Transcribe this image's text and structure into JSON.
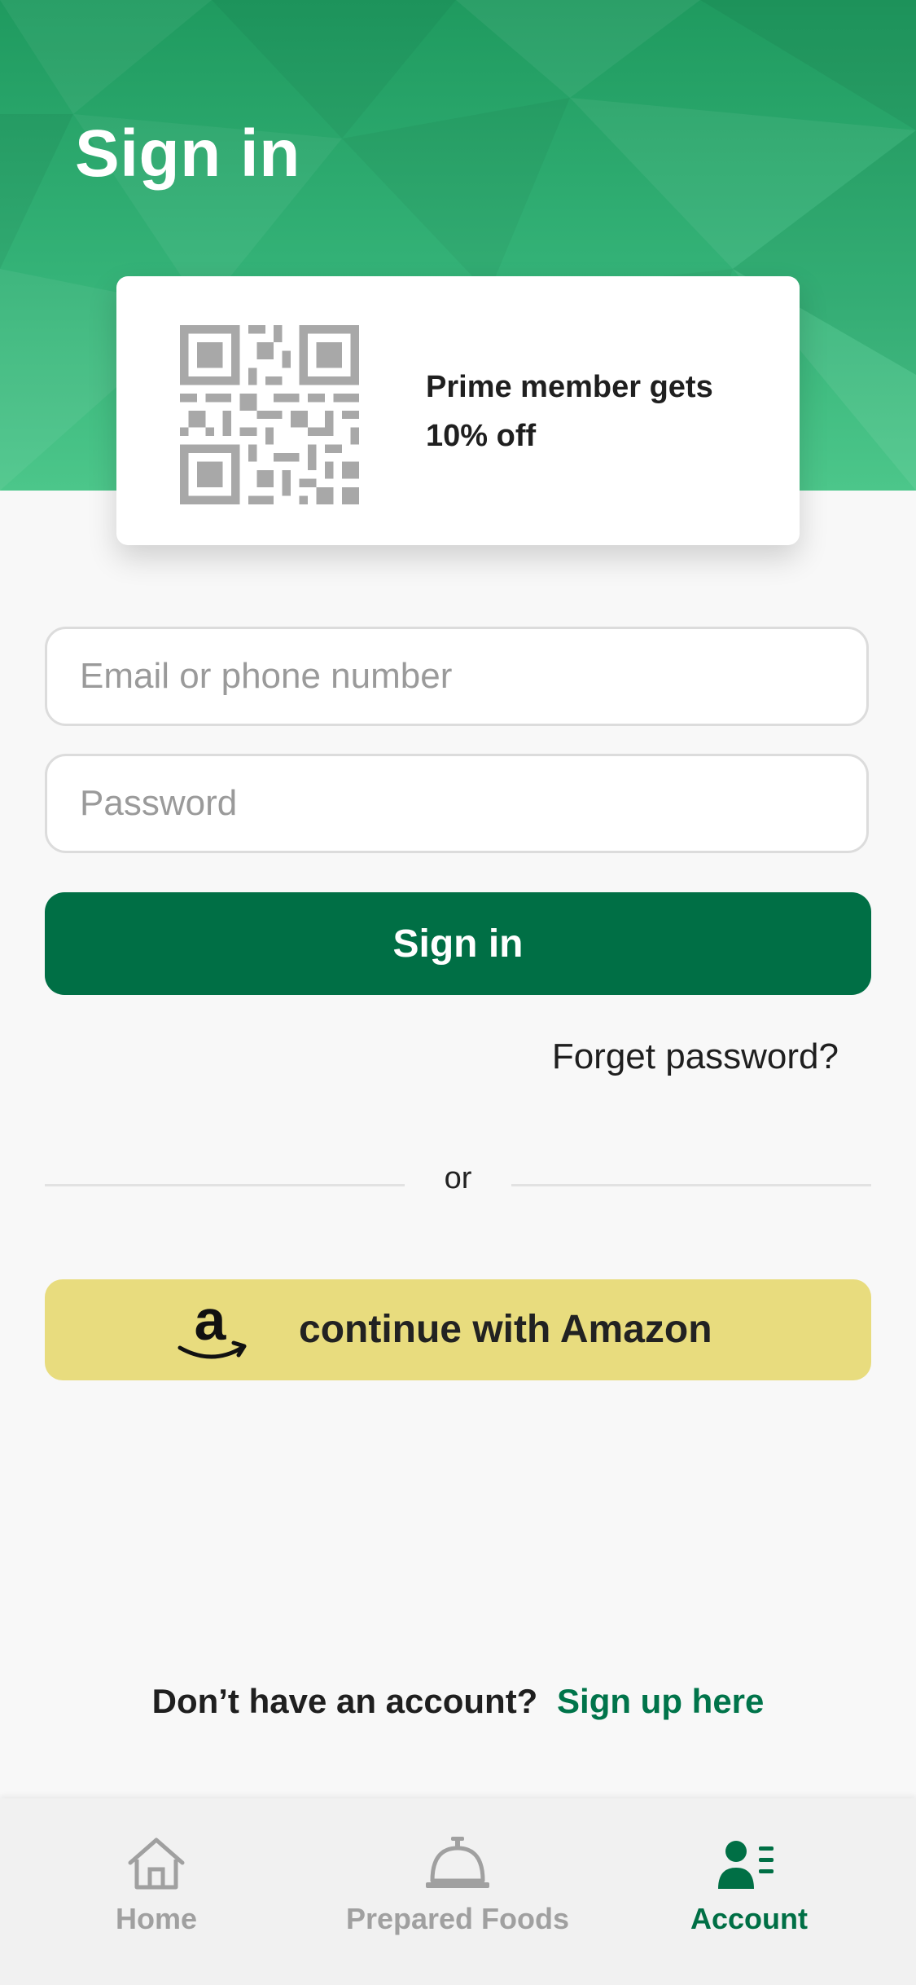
{
  "header": {
    "title": "Sign in"
  },
  "promo": {
    "text_line1": "Prime member gets",
    "text_line2": "10% off"
  },
  "form": {
    "email_placeholder": "Email or phone number",
    "password_placeholder": "Password",
    "sign_in_label": "Sign in",
    "forgot_label": "Forget password?"
  },
  "divider": {
    "label": "or"
  },
  "amazon": {
    "label": "continue with Amazon"
  },
  "signup": {
    "question": "Don’t have an account?",
    "link": "Sign up here"
  },
  "tabbar": {
    "items": [
      {
        "label": "Home",
        "icon": "home-icon",
        "active": false
      },
      {
        "label": "Prepared Foods",
        "icon": "service-bell-icon",
        "active": false
      },
      {
        "label": "Account",
        "icon": "account-icon",
        "active": true
      }
    ]
  },
  "colors": {
    "brand_green": "#006f45",
    "hero_green": "#34b277",
    "amazon_yellow": "#e8dc7e",
    "inactive_gray": "#a0a0a0"
  }
}
